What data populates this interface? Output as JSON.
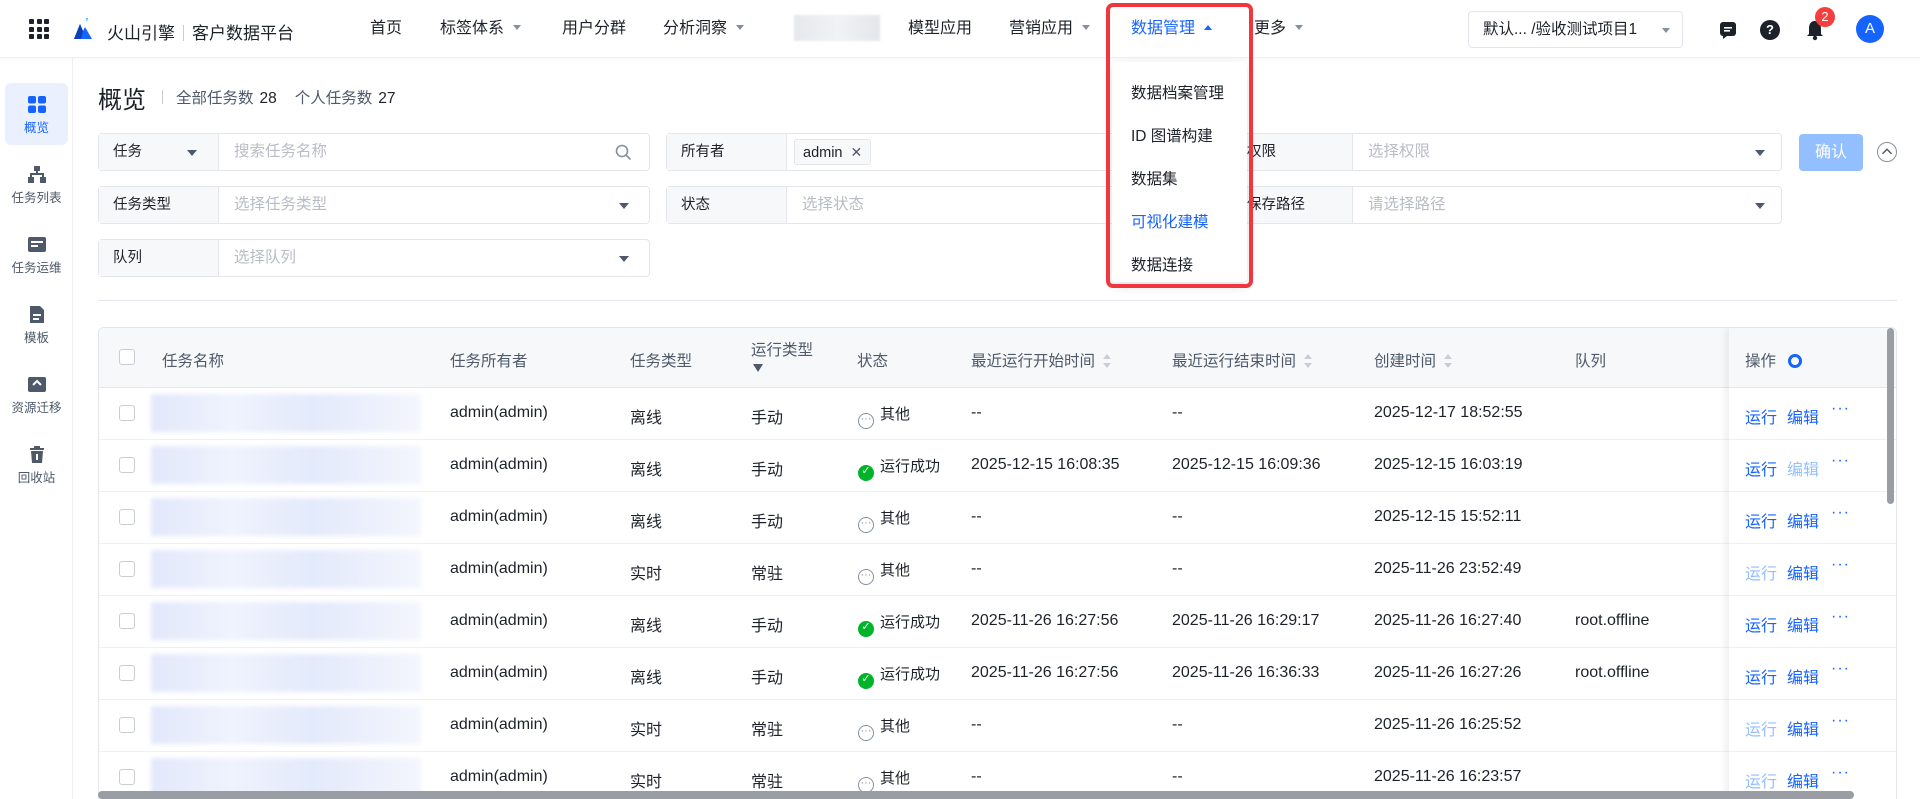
{
  "topbar": {
    "brand": "火山引擎",
    "product": "客户数据平台",
    "nav": [
      {
        "label": "首页",
        "caret": false
      },
      {
        "label": "标签体系",
        "caret": true
      },
      {
        "label": "用户分群",
        "caret": false
      },
      {
        "label": "分析洞察",
        "caret": true
      },
      {
        "label": "模型应用",
        "caret": false
      },
      {
        "label": "营销应用",
        "caret": true
      },
      {
        "label": "数据管理",
        "caret": true,
        "active": true
      },
      {
        "label": "更多",
        "caret": true
      }
    ],
    "project": "默认...   /验收测试项目1",
    "notification_count": "2",
    "avatar": "A",
    "help": "?"
  },
  "dropdown": {
    "items": [
      "数据档案管理",
      "ID 图谱构建",
      "数据集",
      "可视化建模",
      "数据连接"
    ],
    "hovered": "可视化建模"
  },
  "sidebar": {
    "items": [
      {
        "label": "概览",
        "active": true,
        "icon": "grid-icon"
      },
      {
        "label": "任务列表",
        "icon": "tree-icon"
      },
      {
        "label": "任务运维",
        "icon": "ops-icon"
      },
      {
        "label": "模板",
        "icon": "template-icon"
      },
      {
        "label": "资源迁移",
        "icon": "migrate-icon"
      },
      {
        "label": "回收站",
        "icon": "recycle-icon"
      }
    ]
  },
  "overview": {
    "title": "概览",
    "all_label": "全部任务数",
    "all_value": "28",
    "mine_label": "个人任务数",
    "mine_value": "27"
  },
  "filters": {
    "task_select": "任务",
    "task_placeholder": "搜索任务名称",
    "owner_label": "所有者",
    "owner_tag": "admin",
    "perm_label": "权限",
    "perm_placeholder": "选择权限",
    "type_label": "任务类型",
    "type_placeholder": "选择任务类型",
    "status_label": "状态",
    "status_placeholder": "选择状态",
    "path_label": "保存路径",
    "path_placeholder": "请选择路径",
    "queue_label": "队列",
    "queue_placeholder": "选择队列",
    "confirm": "确认"
  },
  "table": {
    "headers": {
      "name": "任务名称",
      "owner": "任务所有者",
      "type": "任务类型",
      "run_type": "运行类型",
      "status": "状态",
      "last_start": "最近运行开始时间",
      "last_end": "最近运行结束时间",
      "created": "创建时间",
      "queue": "队列",
      "ops": "操作"
    },
    "rows": [
      {
        "owner": "admin(admin)",
        "type": "离线",
        "run": "手动",
        "status": "其他",
        "ok": false,
        "start": "--",
        "end": "--",
        "created": "2025-12-17 18:52:55",
        "queue": "",
        "run_enabled": true,
        "edit_enabled": true
      },
      {
        "owner": "admin(admin)",
        "type": "离线",
        "run": "手动",
        "status": "运行成功",
        "ok": true,
        "start": "2025-12-15 16:08:35",
        "end": "2025-12-15 16:09:36",
        "created": "2025-12-15 16:03:19",
        "queue": "",
        "run_enabled": true,
        "edit_enabled": false
      },
      {
        "owner": "admin(admin)",
        "type": "离线",
        "run": "手动",
        "status": "其他",
        "ok": false,
        "start": "--",
        "end": "--",
        "created": "2025-12-15 15:52:11",
        "queue": "",
        "run_enabled": true,
        "edit_enabled": true
      },
      {
        "owner": "admin(admin)",
        "type": "实时",
        "run": "常驻",
        "status": "其他",
        "ok": false,
        "start": "--",
        "end": "--",
        "created": "2025-11-26 23:52:49",
        "queue": "",
        "run_enabled": false,
        "edit_enabled": true
      },
      {
        "owner": "admin(admin)",
        "type": "离线",
        "run": "手动",
        "status": "运行成功",
        "ok": true,
        "start": "2025-11-26 16:27:56",
        "end": "2025-11-26 16:29:17",
        "created": "2025-11-26 16:27:40",
        "queue": "root.offline",
        "run_enabled": true,
        "edit_enabled": true
      },
      {
        "owner": "admin(admin)",
        "type": "离线",
        "run": "手动",
        "status": "运行成功",
        "ok": true,
        "start": "2025-11-26 16:27:56",
        "end": "2025-11-26 16:36:33",
        "created": "2025-11-26 16:27:26",
        "queue": "root.offline",
        "run_enabled": true,
        "edit_enabled": true
      },
      {
        "owner": "admin(admin)",
        "type": "实时",
        "run": "常驻",
        "status": "其他",
        "ok": false,
        "start": "--",
        "end": "--",
        "created": "2025-11-26 16:25:52",
        "queue": "",
        "run_enabled": false,
        "edit_enabled": true
      },
      {
        "owner": "admin(admin)",
        "type": "实时",
        "run": "常驻",
        "status": "其他",
        "ok": false,
        "start": "--",
        "end": "--",
        "created": "2025-11-26 16:23:57",
        "queue": "",
        "run_enabled": false,
        "edit_enabled": true
      }
    ],
    "op_run": "运行",
    "op_edit": "编辑",
    "op_more": "···"
  },
  "colors": {
    "accent": "#1664ff",
    "success": "#00b42a",
    "highlight": "#f0373e",
    "badge": "#f53f3f"
  }
}
